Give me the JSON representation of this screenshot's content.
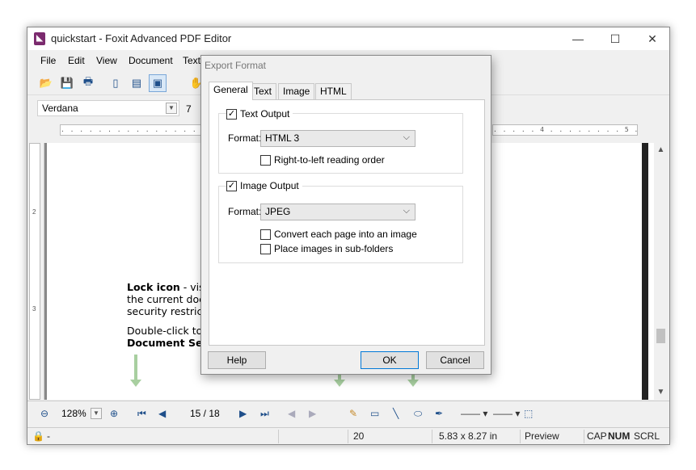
{
  "window": {
    "title": "quickstart - Foxit Advanced PDF Editor",
    "app_icon": "foxit-logo-icon"
  },
  "menu": [
    "File",
    "Edit",
    "View",
    "Document",
    "Text"
  ],
  "toolbar": {
    "icons": [
      "open-folder-icon",
      "save-icon",
      "print-icon",
      "single-page-icon",
      "continuous-page-icon",
      "facing-page-icon",
      "hand-tool-icon"
    ]
  },
  "font": {
    "name": "Verdana",
    "size": "7"
  },
  "ruler": {
    "left_marks": ". . . . . . . . . . . . . . . . .",
    "right_marks": ". . . . . 4 . . . . . . . . 5 ."
  },
  "vruler": [
    "2",
    "3"
  ],
  "document": {
    "line1_bold": "Lock icon",
    "line1_rest": " - vis",
    "line2": "the current doc",
    "line3": "security restric",
    "line4": "Double-click to",
    "line5_bold": "Document Sec"
  },
  "navbar": {
    "zoom": "128%",
    "page": "15 / 18"
  },
  "status": {
    "lock": "-",
    "field": "20",
    "size": "5.83 x 8.27 in",
    "mode": "Preview",
    "cap": "CAP",
    "num": "NUM",
    "scrl": "SCRL"
  },
  "dialog": {
    "title": "Export Format",
    "tabs": [
      "General",
      "Text",
      "Image",
      "HTML"
    ],
    "active_tab": "General",
    "text_output": {
      "label": "Text Output",
      "checked": true,
      "format_label": "Format:",
      "format_value": "HTML 3",
      "rtl_label": "Right-to-left reading order",
      "rtl_checked": false
    },
    "image_output": {
      "label": "Image Output",
      "checked": true,
      "format_label": "Format:",
      "format_value": "JPEG",
      "convert_label": "Convert each page into an image",
      "convert_checked": false,
      "subfolders_label": "Place images in sub-folders",
      "subfolders_checked": false
    },
    "buttons": {
      "help": "Help",
      "ok": "OK",
      "cancel": "Cancel"
    }
  },
  "colors": {
    "accent": "#0078d7",
    "app_icon": "#7b2a6e",
    "arrow": "#a8cfa0"
  }
}
